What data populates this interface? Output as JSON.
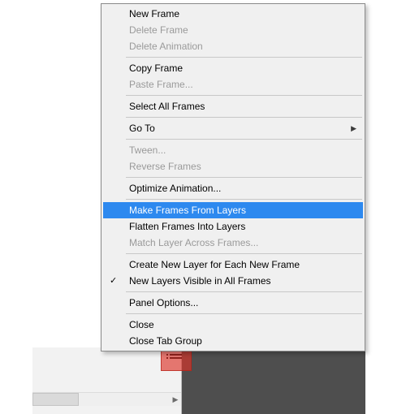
{
  "menu": {
    "items": [
      {
        "label": "New Frame",
        "enabled": true
      },
      {
        "label": "Delete Frame",
        "enabled": false
      },
      {
        "label": "Delete Animation",
        "enabled": false
      },
      {
        "sep": true
      },
      {
        "label": "Copy Frame",
        "enabled": true
      },
      {
        "label": "Paste Frame...",
        "enabled": false
      },
      {
        "sep": true
      },
      {
        "label": "Select All Frames",
        "enabled": true
      },
      {
        "sep": true
      },
      {
        "label": "Go To",
        "enabled": true,
        "submenu": true
      },
      {
        "sep": true
      },
      {
        "label": "Tween...",
        "enabled": false
      },
      {
        "label": "Reverse Frames",
        "enabled": false
      },
      {
        "sep": true
      },
      {
        "label": "Optimize Animation...",
        "enabled": true
      },
      {
        "sep": true
      },
      {
        "label": "Make Frames From Layers",
        "enabled": true,
        "selected": true
      },
      {
        "label": "Flatten Frames Into Layers",
        "enabled": true
      },
      {
        "label": "Match Layer Across Frames...",
        "enabled": false
      },
      {
        "sep": true
      },
      {
        "label": "Create New Layer for Each New Frame",
        "enabled": true
      },
      {
        "label": "New Layers Visible in All Frames",
        "enabled": true,
        "checked": true
      },
      {
        "sep": true
      },
      {
        "label": "Panel Options...",
        "enabled": true
      },
      {
        "sep": true
      },
      {
        "label": "Close",
        "enabled": true
      },
      {
        "label": "Close Tab Group",
        "enabled": true
      }
    ]
  }
}
